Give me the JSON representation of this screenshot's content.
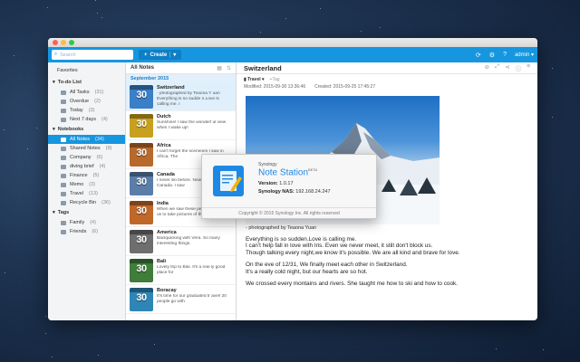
{
  "toolbar": {
    "search_placeholder": "Search",
    "create_label": "Create",
    "create_caret": "▾",
    "user": "admin",
    "user_caret": "▾",
    "icons": [
      "sync-icon",
      "settings-icon",
      "help-icon",
      "user-icon"
    ]
  },
  "sidebar": {
    "favorites": "Favorites",
    "todo_header": "To-do List",
    "todo": [
      {
        "label": "All Tasks",
        "count": "(31)"
      },
      {
        "label": "Overdue",
        "count": "(2)"
      },
      {
        "label": "Today",
        "count": "(3)"
      },
      {
        "label": "Next 7 days",
        "count": "(4)"
      }
    ],
    "notebooks_header": "Notebooks",
    "notebooks": [
      {
        "label": "All Notes",
        "count": "(34)"
      },
      {
        "label": "Shared Notes",
        "count": "(9)"
      },
      {
        "label": "Company",
        "count": "(6)"
      },
      {
        "label": "diving brief",
        "count": "(4)"
      },
      {
        "label": "Finance",
        "count": "(5)"
      },
      {
        "label": "Memo",
        "count": "(3)"
      },
      {
        "label": "Travel",
        "count": "(13)"
      },
      {
        "label": "Recycle Bin",
        "count": "(36)"
      }
    ],
    "tags_header": "Tags",
    "tags": [
      {
        "label": "Family",
        "count": "(4)"
      },
      {
        "label": "Friends",
        "count": "(6)"
      }
    ]
  },
  "list": {
    "title": "All Notes",
    "month": "September 2015",
    "notes": [
      {
        "day": "30",
        "title": "Switzerland",
        "snippet": "- photographed by Teaona Y uan Everything is so sudde n.Love is calling me. I",
        "color": "#3a7fc7"
      },
      {
        "day": "30",
        "title": "Dutch",
        "snippet": "Sunshine! I saw the wonderf ul view when I wake up!",
        "color": "#c8a020"
      },
      {
        "day": "30",
        "title": "Africa",
        "snippet": "I can't forget the sceneries I saw in Africa. The",
        "color": "#b86a2c"
      },
      {
        "day": "30",
        "title": "Canada",
        "snippet": "I never ski before. Now, I ski at Canada. I saw",
        "color": "#5a7ea8"
      },
      {
        "day": "30",
        "title": "India",
        "snippet": "When we saw these people, they want us to take pictures of them. A lady",
        "color": "#c0672a"
      },
      {
        "day": "30",
        "title": "America",
        "snippet": "Backpacking with Vera. So many interesting things.",
        "color": "#6e6e6e"
      },
      {
        "day": "30",
        "title": "Bali",
        "snippet": "Lovely trip to Bali. It's a real ly good place for",
        "color": "#3f7d3b"
      },
      {
        "day": "30",
        "title": "Boracay",
        "snippet": "It's time for our graduated tr avel! 20 people go with",
        "color": "#2f86b6"
      }
    ]
  },
  "note": {
    "title": "Switzerland",
    "notebook": "Travel",
    "tag_placeholder": "+Tag",
    "modified": "Modified: 2015-09-30 13:36:46",
    "created": "Created: 2015-09-25 17:45:27",
    "caption": "- photographed by Teaona Yuan",
    "paragraphs": [
      [
        "Everything is so sudden.Love is calling me.",
        "I can't help fall in love with Iris. Even we never meet, it still don't block us.",
        "Though talking every night,we know it's possible. We are all kind and brave for love."
      ],
      [
        "On the eve of 12/31, We finally meet each other in Switzerland.",
        "It's a really cold night, but our hearts are so hot."
      ],
      [
        "We crossed every montains and rivers. She taught me how to ski and how to cook."
      ]
    ]
  },
  "about": {
    "brand": "Synology",
    "product": "Note Station",
    "beta": "BETA",
    "version_label": "Version:",
    "version": "1.0.17",
    "nas_label": "Synology NAS:",
    "nas": "192.168.24.247",
    "copyright": "Copyright © 2015 Synology Inc. All rights reserved"
  }
}
